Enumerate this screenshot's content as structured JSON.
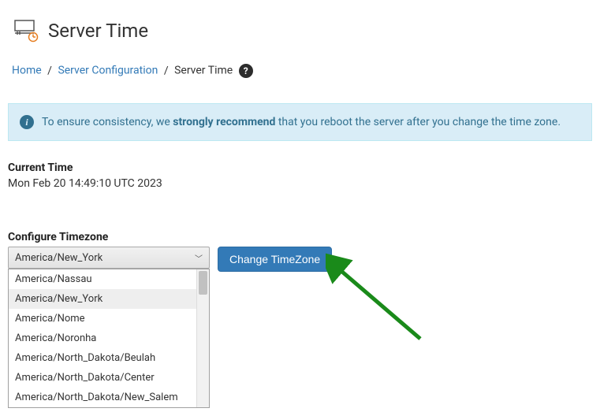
{
  "page": {
    "title": "Server Time"
  },
  "breadcrumb": {
    "home": "Home",
    "server_config": "Server Configuration",
    "current": "Server Time"
  },
  "info": {
    "prefix": "To ensure consistency, we ",
    "emphasis": "strongly recommend",
    "suffix": " that you reboot the server after you change the time zone."
  },
  "current_time": {
    "label": "Current Time",
    "value": "Mon Feb 20 14:49:10 UTC 2023"
  },
  "configure": {
    "label": "Configure Timezone",
    "selected": "America/New_York",
    "button": "Change TimeZone",
    "options": [
      "America/Nassau",
      "America/New_York",
      "America/Nome",
      "America/Noronha",
      "America/North_Dakota/Beulah",
      "America/North_Dakota/Center",
      "America/North_Dakota/New_Salem"
    ]
  }
}
